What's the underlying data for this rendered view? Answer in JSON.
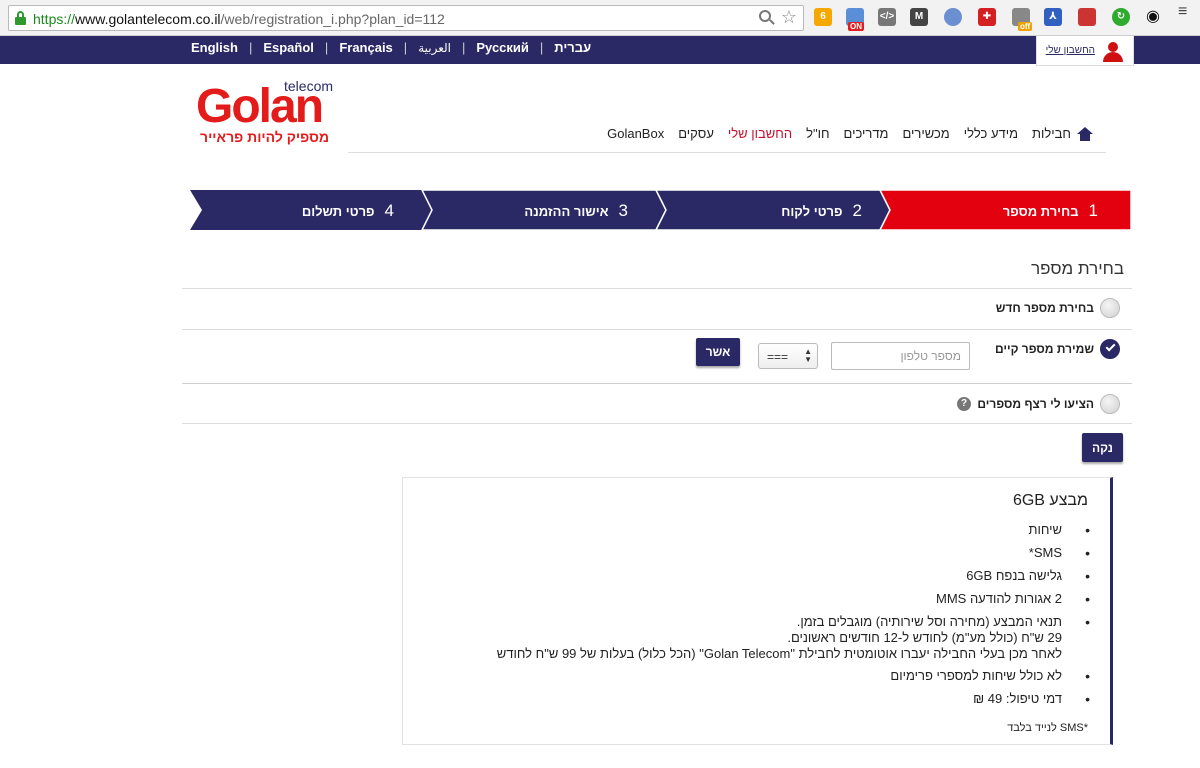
{
  "browser": {
    "url_scheme": "https://",
    "url_domain": "www.golantelecom.co.il",
    "url_path": "/web/registration_i.php?plan_id=112",
    "badge_on": "ON",
    "badge_off": "off"
  },
  "topbar": {
    "languages": [
      "English",
      "Español",
      "Français",
      "العربية",
      "Русский",
      "עברית"
    ],
    "separator": "|",
    "account_label": "החשבון שלי"
  },
  "logo": {
    "telecom": "telecom",
    "word": "Golan",
    "tagline": "מספיק להיות פראייר"
  },
  "nav": {
    "items": [
      "חבילות",
      "מידע כללי",
      "מכשירים",
      "מדריכים",
      "חו\"ל",
      "החשבון שלי",
      "עסקים",
      "GolanBox"
    ]
  },
  "steps": [
    {
      "num": "1",
      "label": "בחירת מספר",
      "active": true
    },
    {
      "num": "2",
      "label": "פרטי לקוח",
      "active": false
    },
    {
      "num": "3",
      "label": "אישור ההזמנה",
      "active": false
    },
    {
      "num": "4",
      "label": "פרטי תשלום",
      "active": false
    }
  ],
  "colors": {
    "brand": "#2a2966",
    "accent": "#e31b1b"
  },
  "section": {
    "title": "בחירת מספר",
    "opt_new": "בחירת מספר חדש",
    "opt_keep": "שמירת מספר קיים",
    "phone_placeholder": "מספר טלפון",
    "prefix_value": "===",
    "confirm": "אשר",
    "opt_range": "הציעו לי רצף מספרים",
    "help": "?",
    "clear": "נקה"
  },
  "plan": {
    "title": "מבצע 6GB",
    "items": [
      "שיחות",
      "SMS*",
      "גלישה בנפח 6GB",
      "2 אגורות להודעה MMS",
      "תנאי המבצע (מחירה וסל שירותיה) מוגבלים בזמן.",
      "29 ש\"ח (כולל מע\"מ) לחודש ל-12 חודשים ראשונים.",
      "לאחר מכן בעלי החבילה יעברו אוטומטית לחבילת \"Golan Telecom\" (הכל כלול) בעלות של 99 ש\"ח לחודש",
      "לא כולל שיחות למספרי פרימיום",
      "דמי טיפול: 49 ₪"
    ],
    "footnote": "*SMS לנייד בלבד"
  }
}
